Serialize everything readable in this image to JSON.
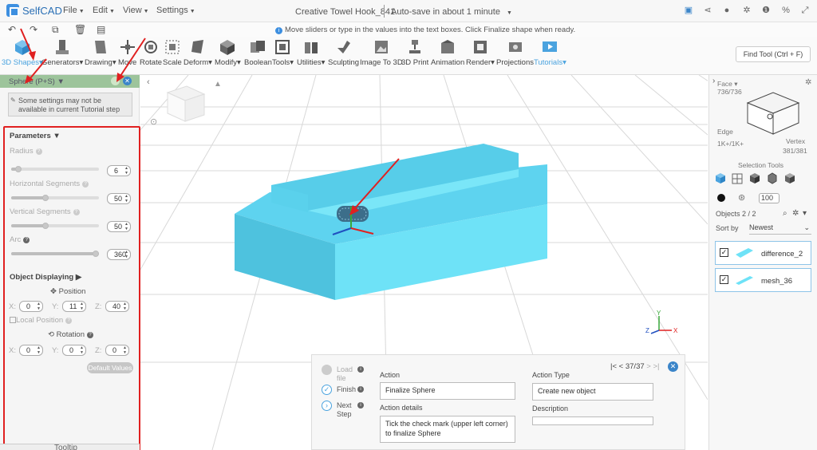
{
  "app": {
    "name": "SelfCAD"
  },
  "menus": [
    {
      "label": "File"
    },
    {
      "label": "Edit"
    },
    {
      "label": "View"
    },
    {
      "label": "Settings"
    }
  ],
  "document": {
    "title": "Creative Towel Hook_841",
    "autosave": "Auto-save in about 1 minute"
  },
  "hint_bar": {
    "message": "Move sliders or type in the values into the text boxes. Click Finalize shape when ready."
  },
  "toolbar": {
    "tools": [
      {
        "label": "3D Shapes"
      },
      {
        "label": "Generators"
      },
      {
        "label": "Drawing"
      },
      {
        "label": "Move"
      },
      {
        "label": "Rotate"
      },
      {
        "label": "Scale"
      },
      {
        "label": "Deform"
      },
      {
        "label": "Modify"
      },
      {
        "label": "Boolean"
      },
      {
        "label": "Tools"
      },
      {
        "label": "Utilities"
      },
      {
        "label": "Sculpting"
      },
      {
        "label": "Image To 3D"
      },
      {
        "label": "3D Print"
      },
      {
        "label": "Animation"
      },
      {
        "label": "Render"
      },
      {
        "label": "Projections"
      },
      {
        "label": "Tutorials"
      }
    ],
    "find_tool": "Find Tool (Ctrl + F)"
  },
  "left_panel": {
    "title": "Sphere (P+S)",
    "warning": "Some settings may not be available in current Tutorial step",
    "parameters_title": "Parameters",
    "params": [
      {
        "label": "Radius",
        "value": "6",
        "fraction": 0.05
      },
      {
        "label": "Horizontal Segments",
        "value": "50",
        "fraction": 0.38
      },
      {
        "label": "Vertical Segments",
        "value": "50",
        "fraction": 0.38
      },
      {
        "label": "Arc",
        "value": "360",
        "fraction": 1.0
      }
    ],
    "object_displaying": "Object Displaying",
    "position_label": "Position",
    "position": {
      "x": "0",
      "y": "11",
      "z": "40"
    },
    "local_position": "Local Position",
    "rotation_label": "Rotation",
    "rotation": {
      "x": "0",
      "y": "0",
      "z": "0"
    },
    "axis_x": "X:",
    "axis_y": "Y:",
    "axis_z": "Z:",
    "default_values": "Default Values",
    "tooltip": "Tooltip"
  },
  "right_panel": {
    "face_label": "Face",
    "face_count": "736/736",
    "edge_label": "Edge",
    "edge_count": "1K+/1K+",
    "vertex_label": "Vertex",
    "vertex_count": "381/381",
    "selection_tools": "Selection Tools",
    "opacity": "100",
    "objects_label": "Objects 2 / 2",
    "sort_by": "Sort by",
    "sort_value": "Newest",
    "objects": [
      {
        "name": "difference_2",
        "checked": true
      },
      {
        "name": "mesh_36",
        "checked": true
      }
    ]
  },
  "action_panel": {
    "steps": [
      {
        "label": "Load file",
        "state": "disabled"
      },
      {
        "label": "Finish",
        "state": "done"
      },
      {
        "label": "Next Step",
        "state": "next"
      }
    ],
    "action_label": "Action",
    "action_value": "Finalize Sphere",
    "action_details_label": "Action details",
    "action_details_value": "Tick the check mark (upper left corner) to finalize Sphere",
    "action_type_label": "Action Type",
    "action_type_value": "Create new object",
    "description_label": "Description",
    "description_value": "",
    "page_indicator": "37/37"
  },
  "viewport": {
    "axis_x": "X",
    "axis_y": "Y",
    "axis_z": "Z"
  },
  "colors": {
    "accent": "#4aa3df",
    "shape": "#6fe0f7",
    "annotation": "#e02020"
  }
}
